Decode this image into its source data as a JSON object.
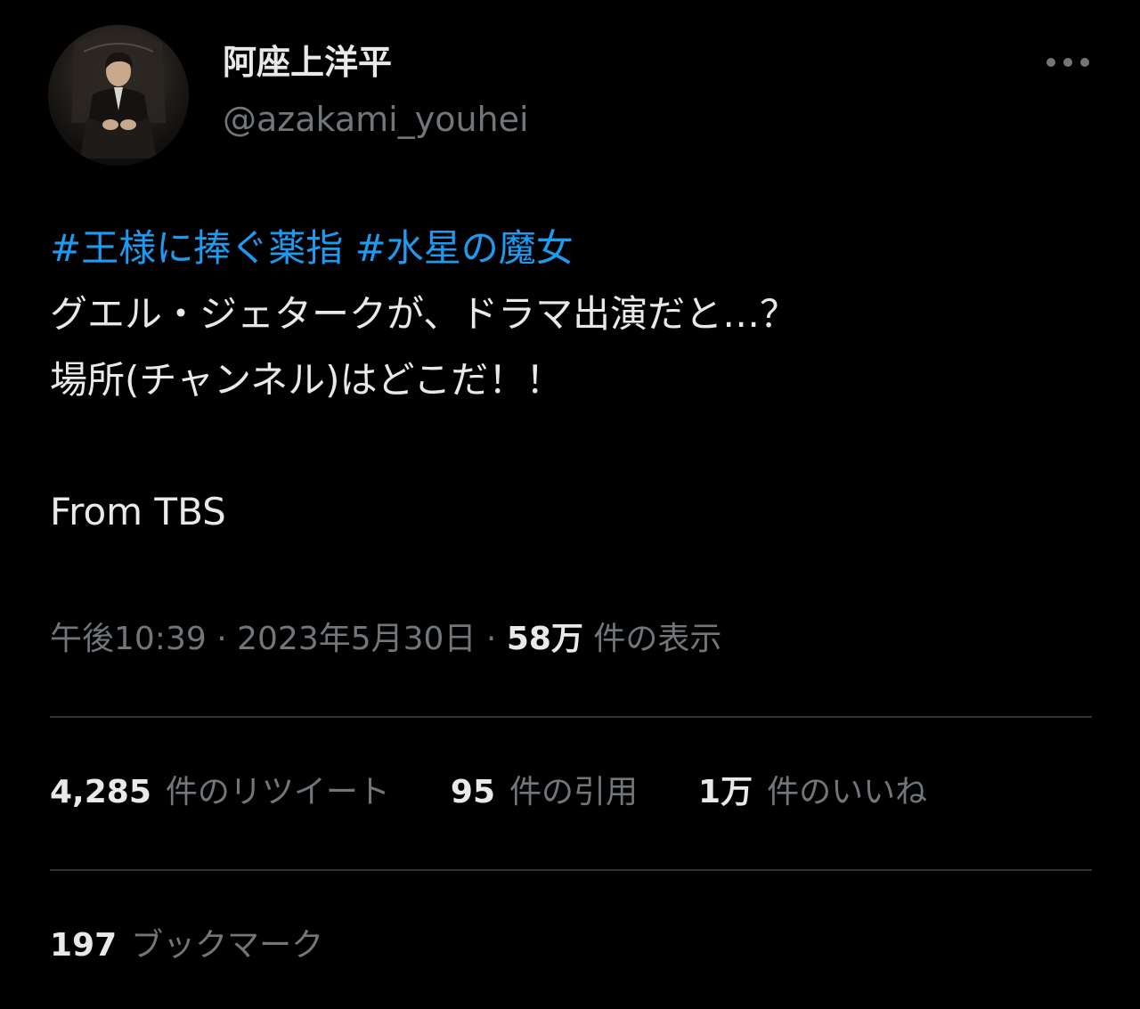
{
  "author": {
    "display_name": "阿座上洋平",
    "handle": "@azakami_youhei"
  },
  "tweet": {
    "hashtags": [
      "#王様に捧ぐ薬指",
      "#水星の魔女"
    ],
    "line1": "グエル・ジェタークが、ドラマ出演だと…？",
    "line2": "場所(チャンネル)はどこだ！！",
    "line3": "From TBS"
  },
  "meta": {
    "time": "午後10:39",
    "separator": "·",
    "date": "2023年5月30日",
    "views_count": "58万",
    "views_label": "件の表示"
  },
  "stats": {
    "retweets_count": "4,285",
    "retweets_label": "件のリツイート",
    "quotes_count": "95",
    "quotes_label": "件の引用",
    "likes_count": "1万",
    "likes_label": "件のいいね",
    "bookmarks_count": "197",
    "bookmarks_label": "ブックマーク"
  },
  "colors": {
    "background": "#000000",
    "text_primary": "#e7e9ea",
    "text_secondary": "#71767b",
    "link": "#1d9bf0",
    "divider": "#2f3336"
  },
  "icons": {
    "more": "more-horizontal-icon"
  }
}
